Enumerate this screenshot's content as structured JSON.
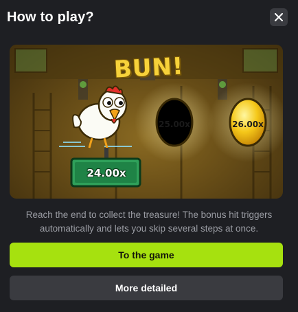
{
  "modal": {
    "title": "How to play?",
    "close_icon": "close-icon"
  },
  "illustration": {
    "bun_text": "BUN!",
    "character": "chicken-icon",
    "eggs": [
      {
        "label": "25.00x"
      },
      {
        "label": "26.00x"
      }
    ],
    "sign_label": "24.00x"
  },
  "description": "Reach the end to collect the treasure! The bonus hit triggers automatically and lets you skip several steps at once.",
  "buttons": {
    "primary_label": "To the game",
    "secondary_label": "More detailed"
  },
  "colors": {
    "background": "#1e1f23",
    "primary_button": "#a6e10f",
    "secondary_button": "#3a3b40",
    "description_text": "#9a9ca3"
  }
}
